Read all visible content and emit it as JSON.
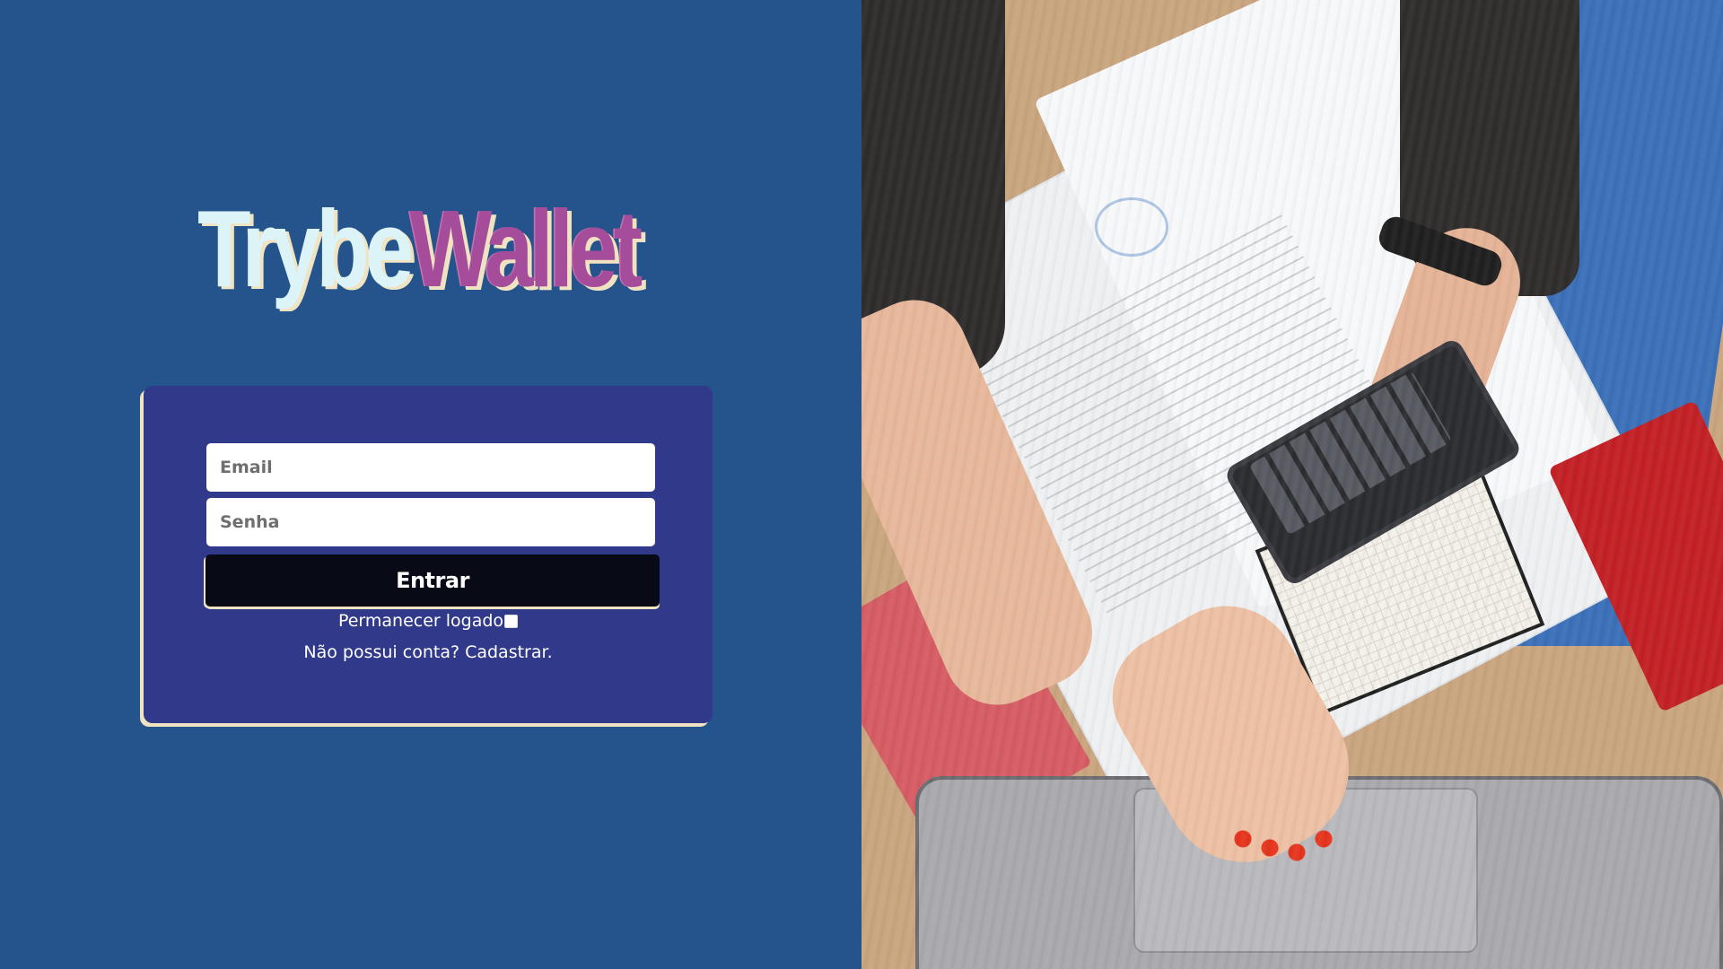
{
  "brand": {
    "logo_part1": "Trybe",
    "logo_part2": "Wallet"
  },
  "login_form": {
    "email_placeholder": "Email",
    "password_placeholder": "Senha",
    "submit_label": "Entrar",
    "remember_label": "Permanecer logado",
    "remember_checked": false,
    "signup_text": "Não possui conta? Cadastrar."
  },
  "hero_image": {
    "description_icon": "finance-photo"
  },
  "colors": {
    "left_panel_bg": "#24548b",
    "card_bg": "#31398a",
    "button_bg": "#080a15",
    "accent_cream": "#f0e3c1",
    "logo_light": "#dcf3f7",
    "logo_purple": "#a54c9b"
  }
}
